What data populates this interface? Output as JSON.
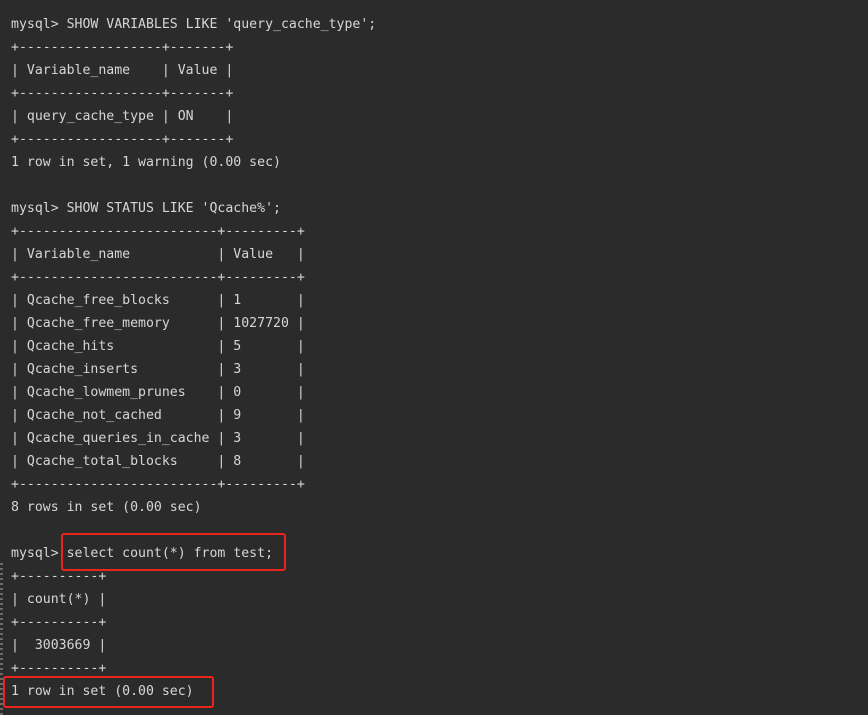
{
  "terminal": {
    "lines": [
      "mysql> SHOW VARIABLES LIKE 'query_cache_type';",
      "+------------------+-------+",
      "| Variable_name    | Value |",
      "+------------------+-------+",
      "| query_cache_type | ON    |",
      "+------------------+-------+",
      "1 row in set, 1 warning (0.00 sec)",
      "",
      "mysql> SHOW STATUS LIKE 'Qcache%';",
      "+-------------------------+---------+",
      "| Variable_name           | Value   |",
      "+-------------------------+---------+",
      "| Qcache_free_blocks      | 1       |",
      "| Qcache_free_memory      | 1027720 |",
      "| Qcache_hits             | 5       |",
      "| Qcache_inserts          | 3       |",
      "| Qcache_lowmem_prunes    | 0       |",
      "| Qcache_not_cached       | 9       |",
      "| Qcache_queries_in_cache | 3       |",
      "| Qcache_total_blocks     | 8       |",
      "+-------------------------+---------+",
      "8 rows in set (0.00 sec)",
      "",
      "mysql> select count(*) from test;",
      "+----------+",
      "| count(*) |",
      "+----------+",
      "|  3003669 |",
      "+----------+",
      "1 row in set (0.00 sec)"
    ]
  },
  "colors": {
    "background": "#2b2b2b",
    "text": "#d6d6d6",
    "highlight_border": "#e8251f"
  }
}
